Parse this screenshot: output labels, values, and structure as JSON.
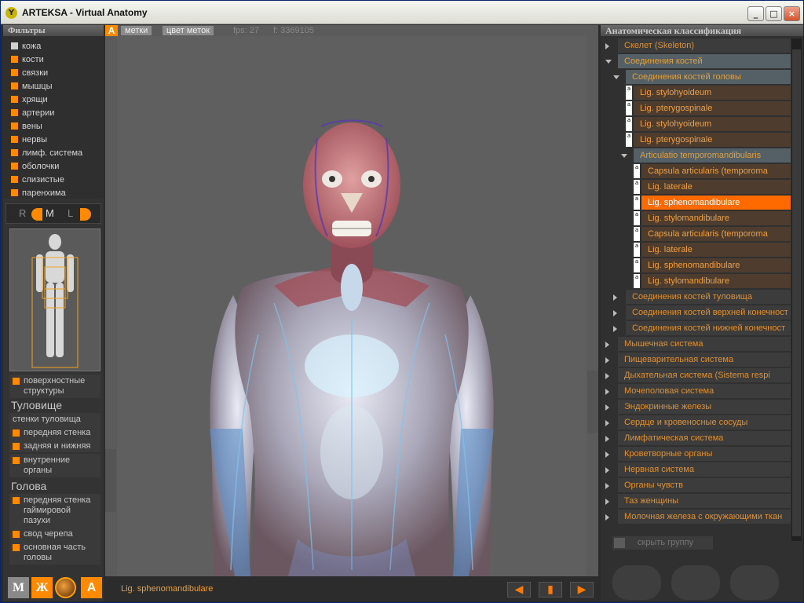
{
  "window": {
    "title": "ARTEKSA - Virtual Anatomy",
    "logo": "Y",
    "min": "_",
    "max": "□",
    "close": "×"
  },
  "filters": {
    "title": "Фильтры",
    "items": [
      {
        "label": "кожа",
        "checked": false
      },
      {
        "label": "кости",
        "checked": true
      },
      {
        "label": "связки",
        "checked": true
      },
      {
        "label": "мышцы",
        "checked": true
      },
      {
        "label": "хрящи",
        "checked": true
      },
      {
        "label": "артерии",
        "checked": true
      },
      {
        "label": "вены",
        "checked": true
      },
      {
        "label": "нервы",
        "checked": true
      },
      {
        "label": "лимф. система",
        "checked": true
      },
      {
        "label": "оболочки",
        "checked": true
      },
      {
        "label": "слизистые",
        "checked": true
      },
      {
        "label": "паренхима",
        "checked": true
      }
    ]
  },
  "rml": {
    "r": "R",
    "m": "M",
    "l": "L"
  },
  "structures": {
    "surface": "поверхностные структуры",
    "torso_heading": "Туловище",
    "torso_items": [
      "стенки туловища",
      "передняя стенка",
      "задняя и нижняя"
    ],
    "internal": "внутренние органы",
    "head_heading": "Голова",
    "head_items": [
      "передняя стенка гаймировой пазухи",
      "свод черепа",
      "основная часть головы"
    ]
  },
  "tools": {
    "m": "М",
    "zh": "Ж",
    "a": "А"
  },
  "center": {
    "a_button": "A",
    "tab_labels": "метки",
    "tab_label_color": "цвет меток",
    "fps": "fps: 27",
    "counter": "f: 3369105",
    "selected": "Lig. sphenomandibulare",
    "prev": "◀",
    "mid": "▮",
    "next": "▶"
  },
  "classification": {
    "title": "Анатомическая классификация",
    "rows": [
      {
        "label": "Скелет (Skeleton)",
        "level": 0,
        "state": "closed"
      },
      {
        "label": "Соединения костей",
        "level": 0,
        "state": "open"
      },
      {
        "label": "Соединения костей головы",
        "level": 1,
        "state": "open"
      },
      {
        "label": "Lig. stylohyoideum",
        "level": 2,
        "state": "leaf"
      },
      {
        "label": "Lig. pterygospinale",
        "level": 2,
        "state": "leaf"
      },
      {
        "label": "Lig. stylohyoideum",
        "level": 2,
        "state": "leaf"
      },
      {
        "label": "Lig. pterygospinale",
        "level": 2,
        "state": "leaf"
      },
      {
        "label": "Articulatio temporomandibularis",
        "level": 2,
        "state": "open"
      },
      {
        "label": "Capsula articularis (temporoma",
        "level": 3,
        "state": "leaf"
      },
      {
        "label": "Lig. laterale",
        "level": 3,
        "state": "leaf"
      },
      {
        "label": "Lig. sphenomandibulare",
        "level": 3,
        "state": "leaf",
        "selected": true
      },
      {
        "label": "Lig. stylomandibulare",
        "level": 3,
        "state": "leaf"
      },
      {
        "label": "Capsula articularis (temporoma",
        "level": 3,
        "state": "leaf"
      },
      {
        "label": "Lig. laterale",
        "level": 3,
        "state": "leaf"
      },
      {
        "label": "Lig. sphenomandibulare",
        "level": 3,
        "state": "leaf"
      },
      {
        "label": "Lig. stylomandibulare",
        "level": 3,
        "state": "leaf"
      },
      {
        "label": "Соединения костей туловища",
        "level": 1,
        "state": "closed"
      },
      {
        "label": "Соединения костей верхней конечност",
        "level": 1,
        "state": "closed"
      },
      {
        "label": "Соединения костей нижней конечност",
        "level": 1,
        "state": "closed"
      },
      {
        "label": "Мышечная система",
        "level": 0,
        "state": "closed"
      },
      {
        "label": "Пищеварительная система",
        "level": 0,
        "state": "closed"
      },
      {
        "label": "Дыхательная система   (Sistema respi",
        "level": 0,
        "state": "closed"
      },
      {
        "label": "Мочеполовая система",
        "level": 0,
        "state": "closed"
      },
      {
        "label": "Эндокринные железы",
        "level": 0,
        "state": "closed"
      },
      {
        "label": "Сердце и кровеносные сосуды",
        "level": 0,
        "state": "closed"
      },
      {
        "label": "Лимфатическая система",
        "level": 0,
        "state": "closed"
      },
      {
        "label": "Кроветворные органы",
        "level": 0,
        "state": "closed"
      },
      {
        "label": "Нервная система",
        "level": 0,
        "state": "closed"
      },
      {
        "label": "Органы чувств",
        "level": 0,
        "state": "closed"
      },
      {
        "label": "Таз женщины",
        "level": 0,
        "state": "closed"
      },
      {
        "label": "Молочная железа с окружающими ткан",
        "level": 0,
        "state": "closed"
      }
    ],
    "hide_group": "скрыть группу"
  },
  "colors": {
    "accent": "#ff8a00",
    "selected_row": "#ff6a00"
  }
}
